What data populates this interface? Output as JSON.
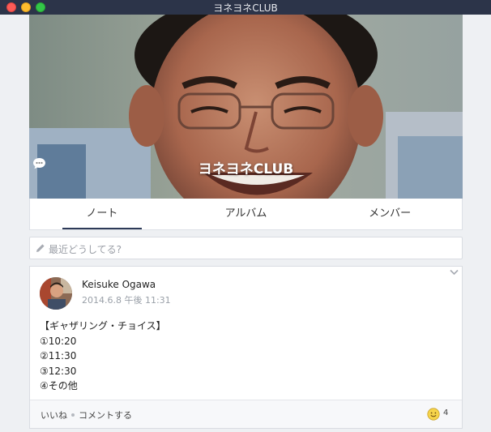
{
  "window": {
    "title": "ヨネヨネCLUB"
  },
  "cover": {
    "group_name": "ヨネヨネCLUB"
  },
  "tabs": [
    {
      "label": "ノート"
    },
    {
      "label": "アルバム"
    },
    {
      "label": "メンバー"
    }
  ],
  "status": {
    "placeholder": "最近どうしてる?"
  },
  "post": {
    "author": "Keisuke Ogawa",
    "date": "2014.6.8 午後 11:31",
    "lines": [
      "【ギャザリング・チョイス】",
      "①10:20",
      "②11:30",
      "③12:30",
      "④その他"
    ],
    "like_label": "いいね",
    "comment_label": "コメントする",
    "reaction_count": "4"
  },
  "colors": {
    "titlebar": "#2c3449",
    "tab_underline": "#2d3a58",
    "background": "#eef0f3"
  }
}
